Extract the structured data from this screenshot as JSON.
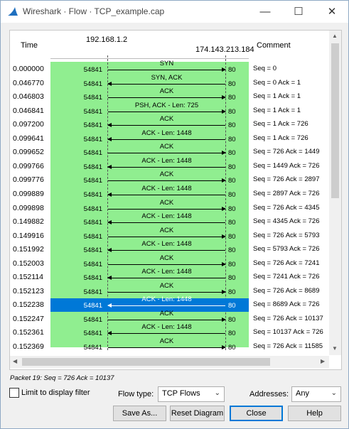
{
  "window": {
    "title": "Wireshark · Flow · TCP_example.cap"
  },
  "columns": {
    "time": "Time",
    "comment": "Comment"
  },
  "hosts": {
    "left": "192.168.1.2",
    "right": "174.143.213.184"
  },
  "flows": [
    {
      "time": "0.000000",
      "label": "SYN",
      "src_port": "54841",
      "dst_port": "80",
      "dir": "right",
      "comment": "Seq = 0"
    },
    {
      "time": "0.046770",
      "label": "SYN, ACK",
      "src_port": "54841",
      "dst_port": "80",
      "dir": "left",
      "comment": "Seq = 0 Ack = 1"
    },
    {
      "time": "0.046803",
      "label": "ACK",
      "src_port": "54841",
      "dst_port": "80",
      "dir": "right",
      "comment": "Seq = 1 Ack = 1"
    },
    {
      "time": "0.046841",
      "label": "PSH, ACK - Len: 725",
      "src_port": "54841",
      "dst_port": "80",
      "dir": "right",
      "comment": "Seq = 1 Ack = 1"
    },
    {
      "time": "0.097200",
      "label": "ACK",
      "src_port": "54841",
      "dst_port": "80",
      "dir": "left",
      "comment": "Seq = 1 Ack = 726"
    },
    {
      "time": "0.099641",
      "label": "ACK - Len: 1448",
      "src_port": "54841",
      "dst_port": "80",
      "dir": "left",
      "comment": "Seq = 1 Ack = 726"
    },
    {
      "time": "0.099652",
      "label": "ACK",
      "src_port": "54841",
      "dst_port": "80",
      "dir": "right",
      "comment": "Seq = 726 Ack = 1449"
    },
    {
      "time": "0.099766",
      "label": "ACK - Len: 1448",
      "src_port": "54841",
      "dst_port": "80",
      "dir": "left",
      "comment": "Seq = 1449 Ack = 726"
    },
    {
      "time": "0.099776",
      "label": "ACK",
      "src_port": "54841",
      "dst_port": "80",
      "dir": "right",
      "comment": "Seq = 726 Ack = 2897"
    },
    {
      "time": "0.099889",
      "label": "ACK - Len: 1448",
      "src_port": "54841",
      "dst_port": "80",
      "dir": "left",
      "comment": "Seq = 2897 Ack = 726"
    },
    {
      "time": "0.099898",
      "label": "ACK",
      "src_port": "54841",
      "dst_port": "80",
      "dir": "right",
      "comment": "Seq = 726 Ack = 4345"
    },
    {
      "time": "0.149882",
      "label": "ACK - Len: 1448",
      "src_port": "54841",
      "dst_port": "80",
      "dir": "left",
      "comment": "Seq = 4345 Ack = 726"
    },
    {
      "time": "0.149916",
      "label": "ACK",
      "src_port": "54841",
      "dst_port": "80",
      "dir": "right",
      "comment": "Seq = 726 Ack = 5793"
    },
    {
      "time": "0.151992",
      "label": "ACK - Len: 1448",
      "src_port": "54841",
      "dst_port": "80",
      "dir": "left",
      "comment": "Seq = 5793 Ack = 726"
    },
    {
      "time": "0.152003",
      "label": "ACK",
      "src_port": "54841",
      "dst_port": "80",
      "dir": "right",
      "comment": "Seq = 726 Ack = 7241"
    },
    {
      "time": "0.152114",
      "label": "ACK - Len: 1448",
      "src_port": "54841",
      "dst_port": "80",
      "dir": "left",
      "comment": "Seq = 7241 Ack = 726"
    },
    {
      "time": "0.152123",
      "label": "ACK",
      "src_port": "54841",
      "dst_port": "80",
      "dir": "right",
      "comment": "Seq = 726 Ack = 8689"
    },
    {
      "time": "0.152238",
      "label": "ACK - Len: 1448",
      "src_port": "54841",
      "dst_port": "80",
      "dir": "left",
      "comment": "Seq = 8689 Ack = 726"
    },
    {
      "time": "0.152247",
      "label": "ACK",
      "src_port": "54841",
      "dst_port": "80",
      "dir": "right",
      "comment": "Seq = 726 Ack = 10137"
    },
    {
      "time": "0.152361",
      "label": "ACK - Len: 1448",
      "src_port": "54841",
      "dst_port": "80",
      "dir": "left",
      "comment": "Seq = 10137 Ack = 726"
    },
    {
      "time": "0.152369",
      "label": "ACK",
      "src_port": "54841",
      "dst_port": "80",
      "dir": "right",
      "comment": "Seq = 726 Ack = 11585"
    }
  ],
  "selected_index": 17,
  "status": "Packet 19: Seq = 726 Ack = 10137",
  "controls": {
    "limit_label": "Limit to display filter",
    "flow_type_label": "Flow type:",
    "flow_type_value": "TCP Flows",
    "addresses_label": "Addresses:",
    "addresses_value": "Any"
  },
  "buttons": {
    "save_as": "Save As...",
    "reset": "Reset Diagram",
    "close": "Close",
    "help": "Help"
  }
}
